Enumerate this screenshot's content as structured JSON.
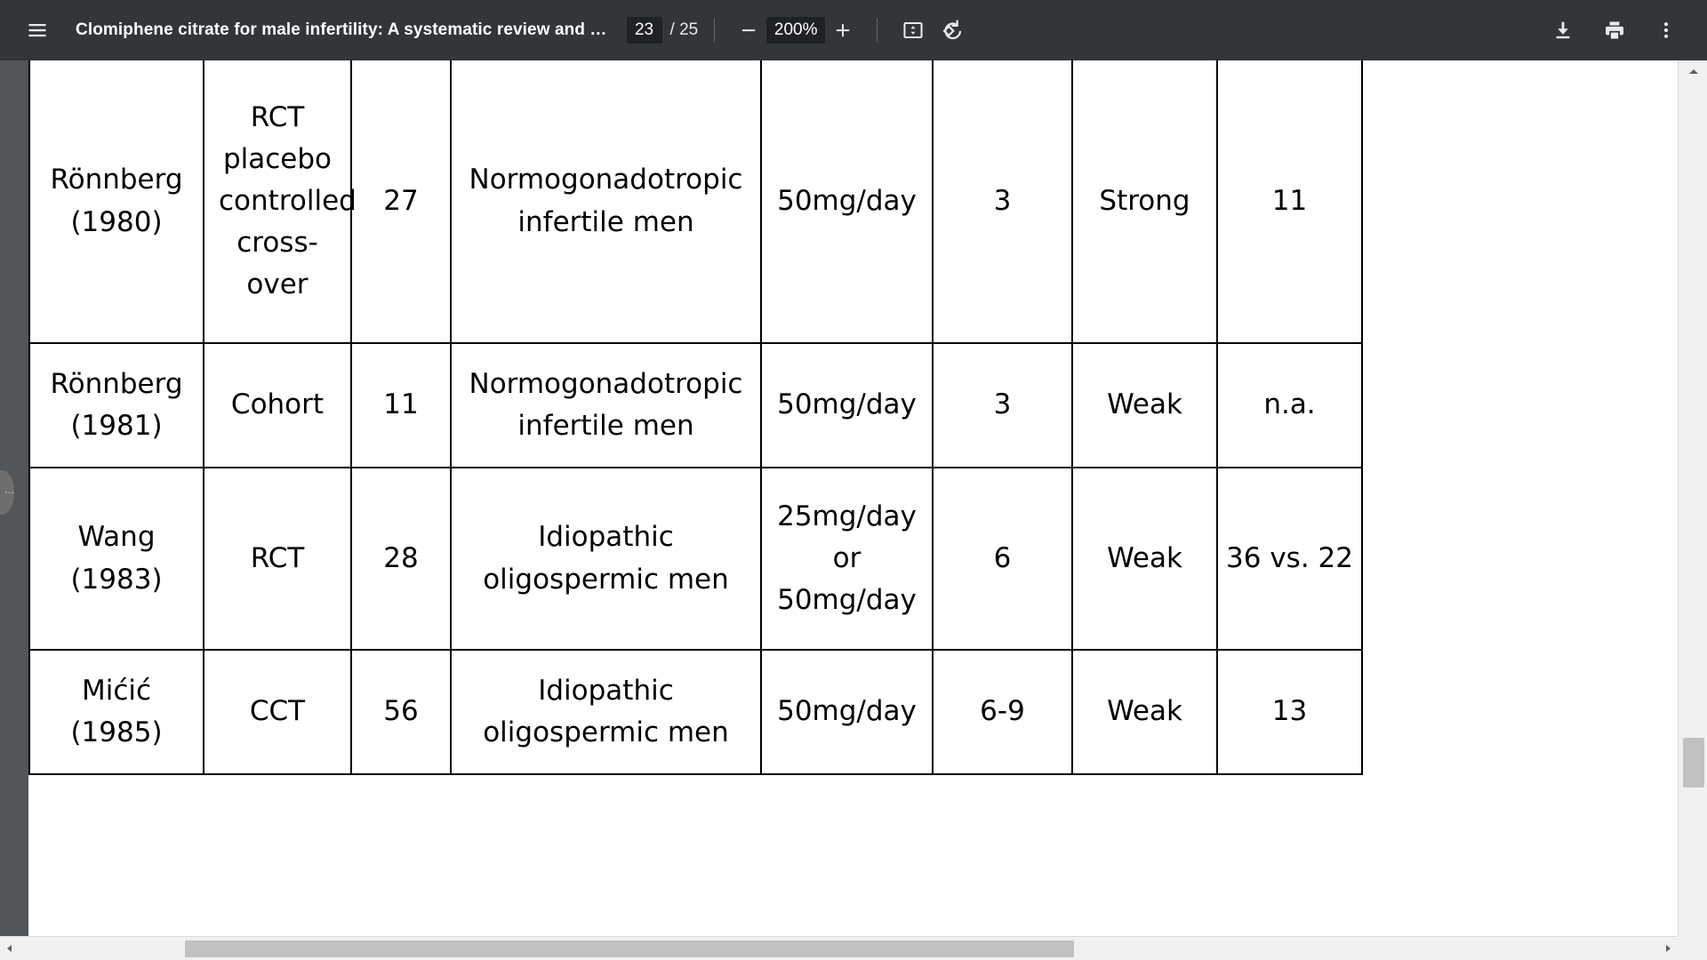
{
  "toolbar": {
    "menu_icon": "hamburger-menu-icon",
    "document_title": "Clomiphene citrate for male infertility: A systematic review and …",
    "current_page": "23",
    "page_total": "/ 25",
    "zoom_out_icon": "minus-icon",
    "zoom_level": "200%",
    "zoom_in_icon": "plus-icon",
    "fit_page_icon": "fit-to-page-icon",
    "rotate_icon": "rotate-counterclockwise-icon",
    "download_icon": "download-icon",
    "print_icon": "print-icon",
    "more_icon": "more-vertical-icon",
    "colors": {
      "bar_bg": "#323639",
      "field_bg": "#202124",
      "text": "#e8eaed"
    }
  },
  "viewer": {
    "background": "#525659",
    "page_background": "#ffffff",
    "sidebar_handle_icon": "panel-expand-handle-icon",
    "vertical_scrollbar": {
      "up_arrow_icon": "caret-up-icon",
      "down_arrow_icon": "caret-down-icon",
      "thumb_color": "#c1c1c1"
    },
    "horizontal_scrollbar": {
      "left_arrow_icon": "caret-left-icon",
      "right_arrow_icon": "caret-right-icon",
      "thumb_color": "#c1c1c1"
    }
  },
  "table": {
    "columns": [
      "author_year",
      "study_design",
      "n",
      "population",
      "dose",
      "duration_months",
      "evidence",
      "pregnancies"
    ],
    "rows": [
      {
        "author_year": "Rönnberg\n(1980)",
        "author_line1": "Rönnberg",
        "author_line2": "(1980)",
        "study_design": "RCT placebo controlled cross-over",
        "n": "27",
        "population_line1": "Normogonadotropic",
        "population_line2": "infertile men",
        "dose": "50mg/day",
        "duration_months": "3",
        "evidence": "Strong",
        "pregnancies": "11"
      },
      {
        "author_line1": "Rönnberg",
        "author_line2": "(1981)",
        "study_design": "Cohort",
        "n": "11",
        "population_line1": "Normogonadotropic",
        "population_line2": "infertile men",
        "dose": "50mg/day",
        "duration_months": "3",
        "evidence": "Weak",
        "pregnancies": "n.a."
      },
      {
        "author_line1": "Wang",
        "author_line2": "(1983)",
        "study_design": "RCT",
        "n": "28",
        "population_line1": "Idiopathic",
        "population_line2": "oligospermic men",
        "dose_line1": "25mg/day",
        "dose_line2": "or",
        "dose_line3": "50mg/day",
        "duration_months": "6",
        "evidence": "Weak",
        "pregnancies": "36 vs. 22"
      },
      {
        "author_line1": "Mićić",
        "author_line2": "(1985)",
        "study_design": "CCT",
        "n": "56",
        "population_line1": "Idiopathic",
        "population_line2": "oligospermic men",
        "dose": "50mg/day",
        "duration_months": "6-9",
        "evidence": "Weak",
        "pregnancies": "13"
      }
    ]
  }
}
